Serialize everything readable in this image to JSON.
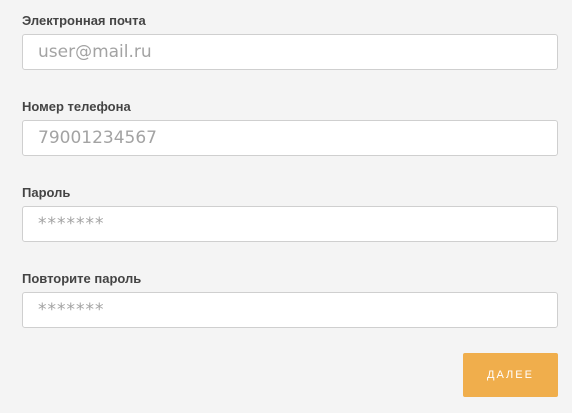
{
  "form": {
    "email": {
      "label": "Электронная почта",
      "placeholder": "user@mail.ru",
      "value": ""
    },
    "phone": {
      "label": "Номер телефона",
      "placeholder": "79001234567",
      "value": ""
    },
    "password": {
      "label": "Пароль",
      "placeholder": "*******",
      "value": ""
    },
    "password_repeat": {
      "label": "Повторите пароль",
      "placeholder": "*******",
      "value": ""
    },
    "next_label": "ДАЛЕЕ"
  },
  "colors": {
    "background": "#f4f4f4",
    "input_border": "#cfcfcf",
    "label_text": "#444444",
    "placeholder_text": "#a3a3a3",
    "button_bg": "#f0ae4c",
    "button_text": "#ffffff"
  }
}
